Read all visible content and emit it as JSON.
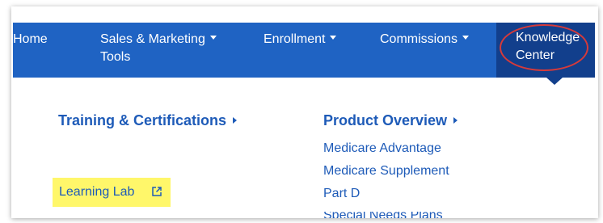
{
  "nav": {
    "items": [
      {
        "label": "Home"
      },
      {
        "label": "Sales & Marketing",
        "label2": "Tools"
      },
      {
        "label": "Enrollment"
      },
      {
        "label": "Commissions"
      }
    ],
    "active": {
      "label": "Knowledge",
      "label2": "Center"
    }
  },
  "menu": {
    "left_heading": "Training & Certifications",
    "right_heading": "Product Overview",
    "product_links": [
      "Medicare Advantage",
      "Medicare Supplement",
      "Part D",
      "Special Needs Plans"
    ],
    "highlighted_link": "Learning Lab"
  },
  "colors": {
    "nav_bg": "#1f63c3",
    "active_bg": "#123f8c",
    "link": "#1e5bb8",
    "highlight": "#fff76a",
    "annotation": "#d63a3a"
  },
  "icons": {
    "external": "external-link-icon"
  }
}
